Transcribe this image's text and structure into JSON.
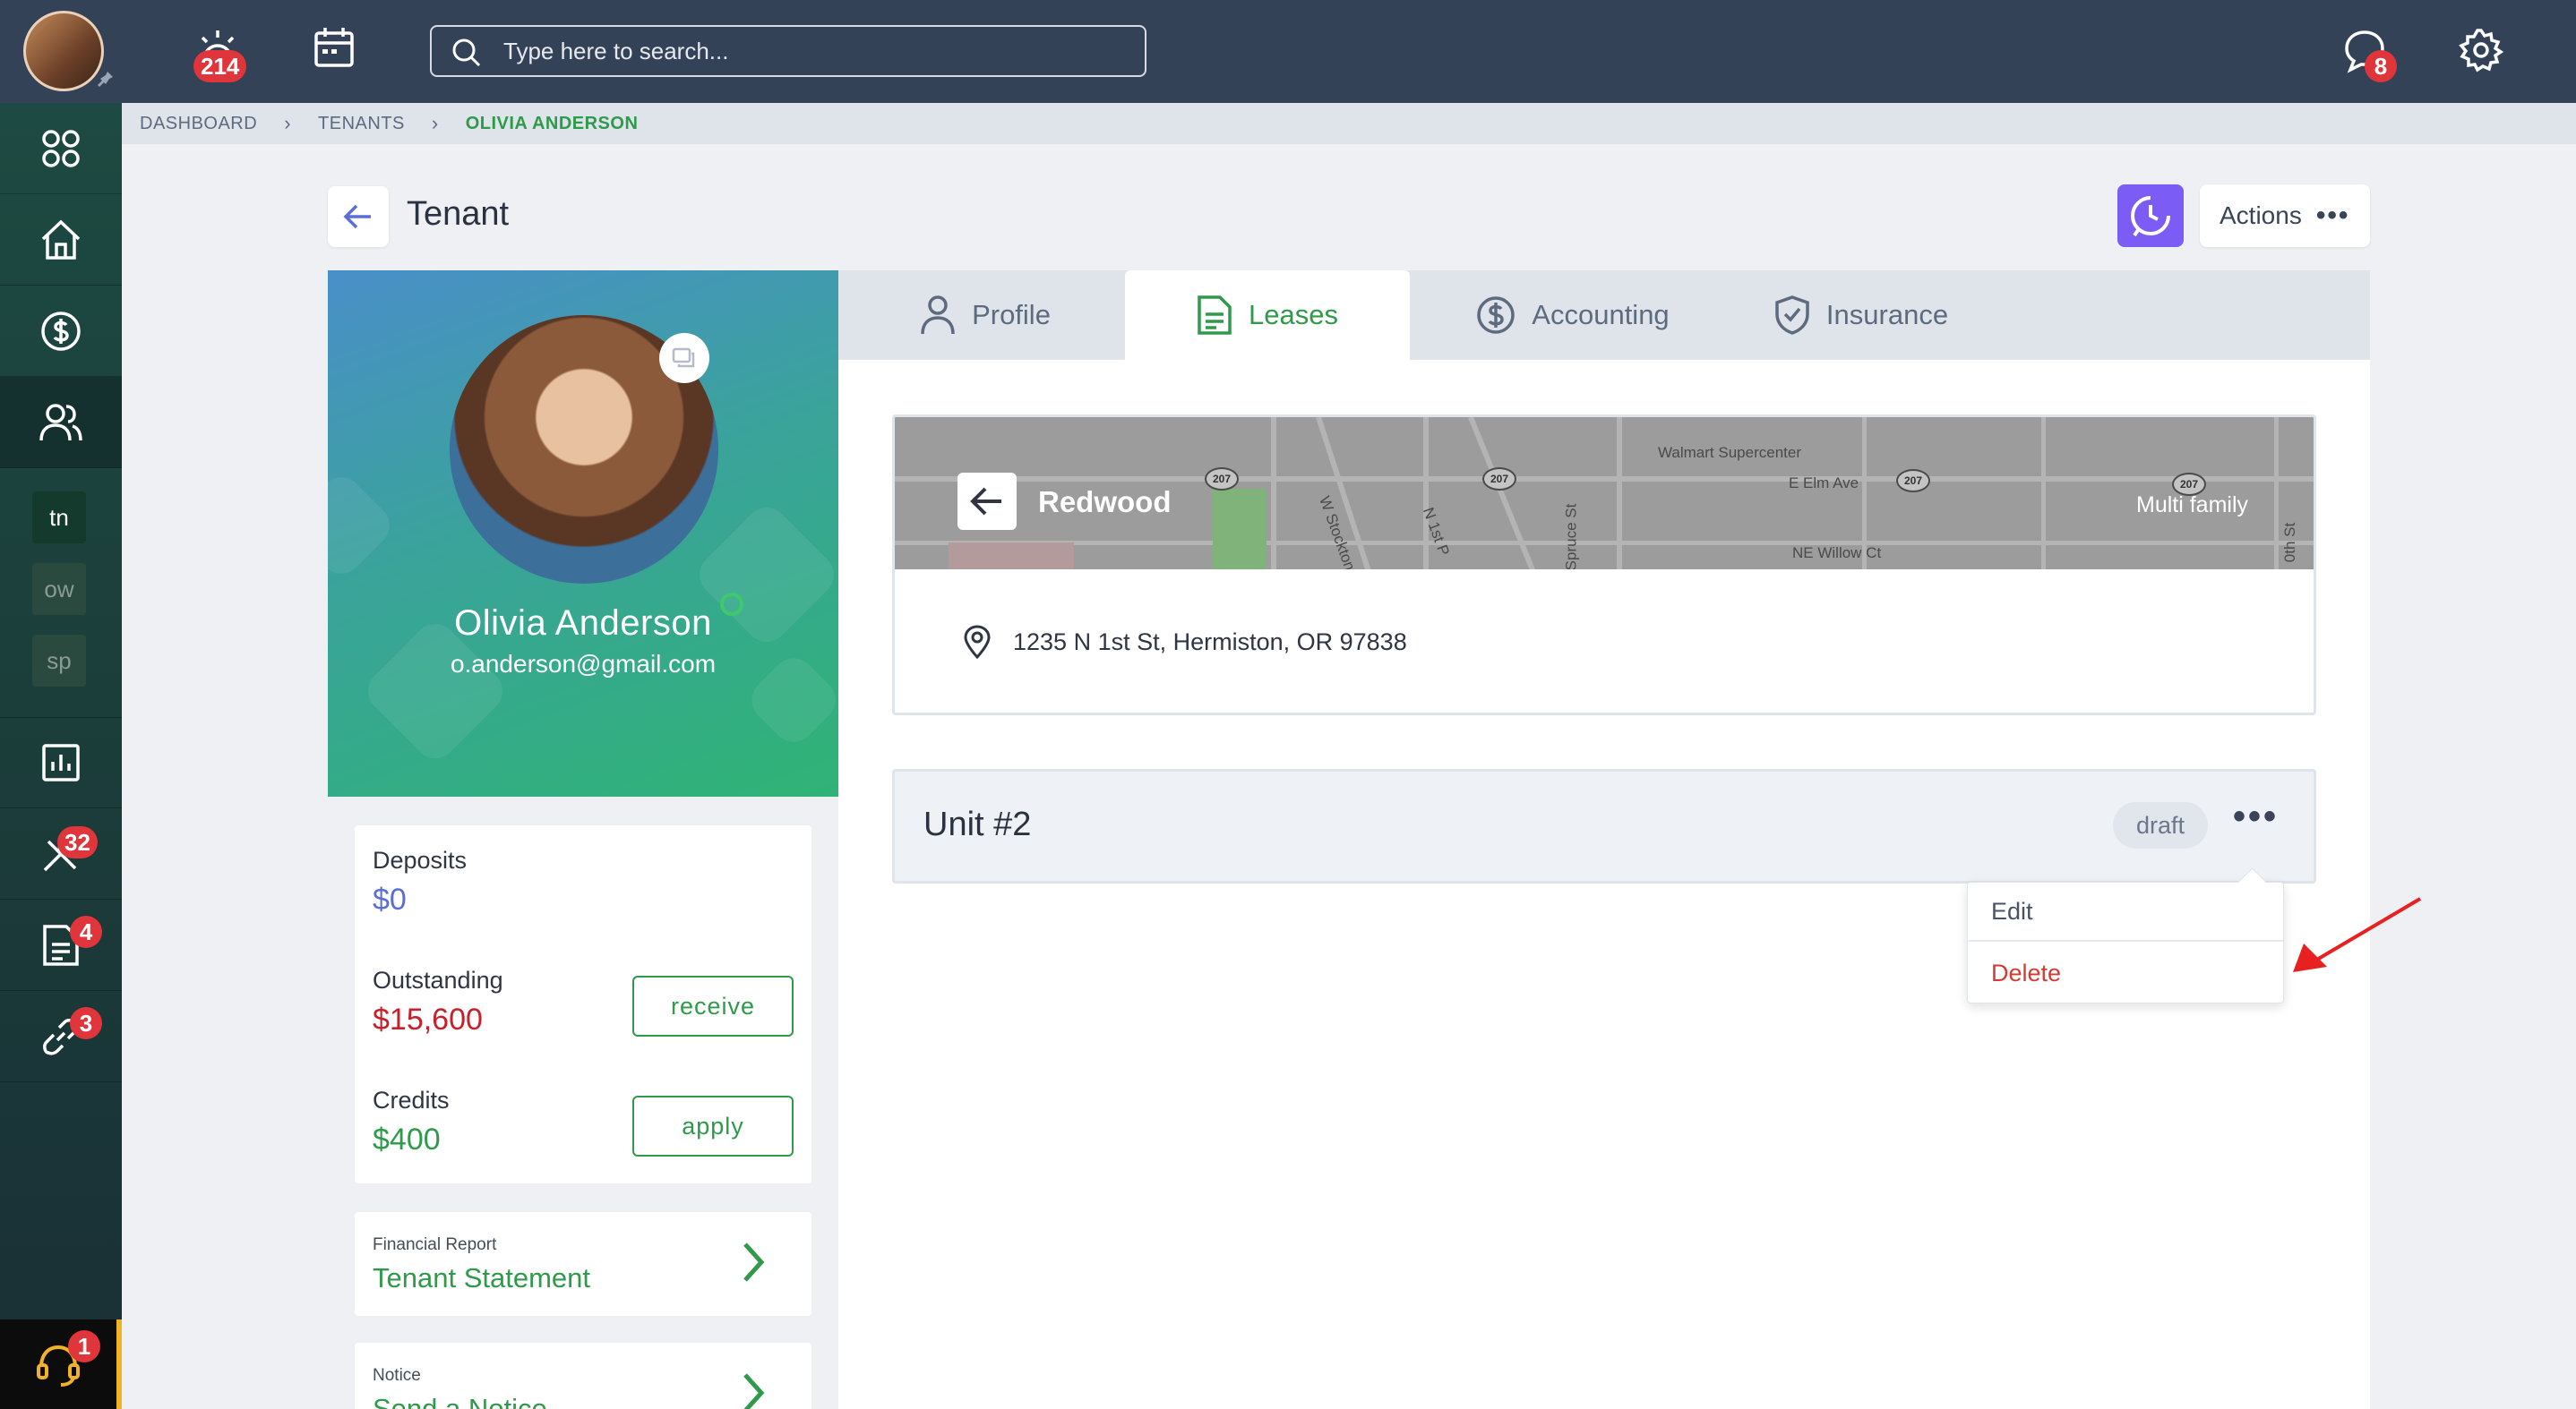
{
  "topbar": {
    "notifications_count": "214",
    "messages_count": "8",
    "search_placeholder": "Type here to search..."
  },
  "sidebar": {
    "mini_items": [
      "tn",
      "ow",
      "sp"
    ],
    "maintenance_count": "32",
    "documents_count": "4",
    "links_count": "3",
    "support_count": "1"
  },
  "breadcrumb": {
    "items": [
      "DASHBOARD",
      "TENANTS",
      "OLIVIA ANDERSON"
    ]
  },
  "header": {
    "title": "Tenant",
    "actions_label": "Actions"
  },
  "profile": {
    "name": "Olivia Anderson",
    "email": "o.anderson@gmail.com"
  },
  "finance": {
    "deposits_label": "Deposits",
    "deposits_value": "$0",
    "outstanding_label": "Outstanding",
    "outstanding_value": "$15,600",
    "receive_label": "receive",
    "credits_label": "Credits",
    "credits_value": "$400",
    "apply_label": "apply"
  },
  "reports": [
    {
      "small": "Financial Report",
      "big": "Tenant Statement"
    },
    {
      "small": "Notice",
      "big": "Send a Notice"
    }
  ],
  "tabs": [
    {
      "label": "Profile",
      "active": false
    },
    {
      "label": "Leases",
      "active": true
    },
    {
      "label": "Accounting",
      "active": false
    },
    {
      "label": "Insurance",
      "active": false
    }
  ],
  "property": {
    "name": "Redwood",
    "type": "Multi family",
    "address": "1235 N 1st St, Hermiston, OR 97838",
    "map_labels": {
      "store": "Walmart Supercenter",
      "street1": "E Elm Ave",
      "street2": "NE Willow Ct",
      "street3": "W Stockton",
      "street4": "N 1st P",
      "street5": "Spruce St",
      "street6": "0th St",
      "hwy": "207"
    }
  },
  "unit": {
    "title": "Unit #2",
    "status": "draft"
  },
  "dropdown": {
    "edit_label": "Edit",
    "delete_label": "Delete"
  },
  "colors": {
    "topbar": "#344258",
    "accent_green": "#2f9a4a",
    "outstanding_red": "#c8202a",
    "deposits_blue": "#5b6ed8",
    "delete_red": "#d43b33",
    "badge_red": "#e0353b",
    "clock_purple": "#7b5cf5"
  }
}
